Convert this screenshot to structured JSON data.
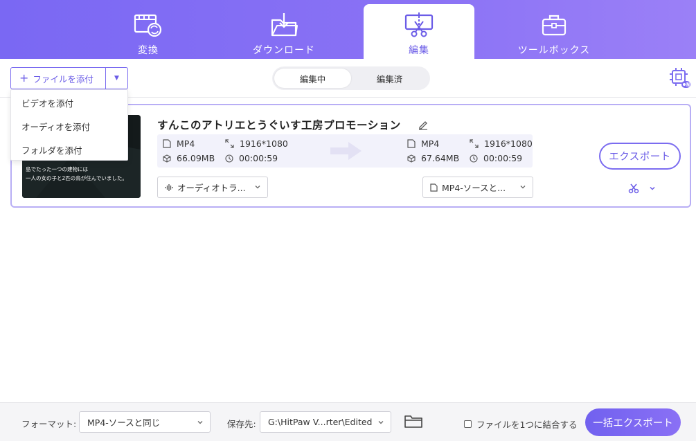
{
  "nav": {
    "tabs": [
      {
        "label": "変換",
        "icon": "video-convert-icon"
      },
      {
        "label": "ダウンロード",
        "icon": "download-folder-icon"
      },
      {
        "label": "編集",
        "icon": "edit-cut-icon"
      },
      {
        "label": "ツールボックス",
        "icon": "toolbox-icon"
      }
    ],
    "active": "編集"
  },
  "toolbar": {
    "add_file_label": "ファイルを添付",
    "segments": [
      "編集中",
      "編集済"
    ],
    "active_segment": "編集中"
  },
  "add_menu": {
    "items": [
      "ビデオを添付",
      "オーディオを添付",
      "フォルダを添付"
    ]
  },
  "file": {
    "title": "すんこのアトリエとうぐいす工房プロモーション",
    "thumbnail_caption": [
      "島でたった一つの建物には",
      "一人の女の子と2匹の鳥が住んでいました。"
    ],
    "source": {
      "format": "MP4",
      "resolution": "1916*1080",
      "size": "66.09MB",
      "duration": "00:00:59"
    },
    "output": {
      "format": "MP4",
      "resolution": "1916*1080",
      "size": "67.64MB",
      "duration": "00:00:59"
    },
    "audio_track": "オーディオトラ...",
    "output_format": "MP4-ソースと...",
    "export_label": "エクスポート"
  },
  "bottom": {
    "format_label": "フォーマット:",
    "format_value": "MP4-ソースと同じ",
    "save_label": "保存先:",
    "save_path": "G:\\HitPaw V...rter\\Edited",
    "merge_label": "ファイルを1つに結合する",
    "merge_checked": false,
    "batch_export_label": "一括エクスポート"
  },
  "colors": {
    "accent": "#7b6cf0",
    "nav_bg": "#8a72f5"
  }
}
